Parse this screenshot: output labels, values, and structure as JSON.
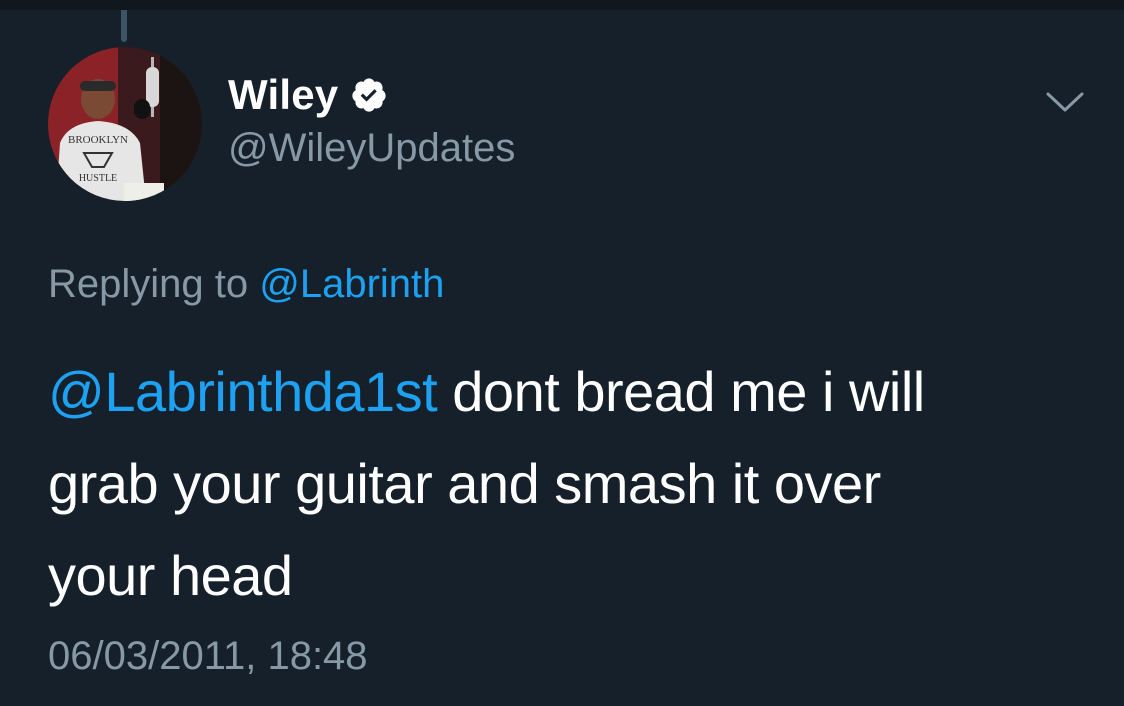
{
  "author": {
    "display_name": "Wiley",
    "handle": "@WileyUpdates",
    "verified": true,
    "avatar_shirt_text_top": "BROOKLYN",
    "avatar_shirt_text_bottom": "HUSTLE"
  },
  "reply": {
    "prefix": "Replying to",
    "target": "@Labrinth"
  },
  "tweet": {
    "mention": "@Labrinthda1st",
    "line1_rest": " dont bread me i will",
    "line2": "grab your guitar and smash it over",
    "line3": "your head"
  },
  "timestamp": "06/03/2011, 18:48",
  "icons": {
    "verified": "verified-badge-icon",
    "menu": "chevron-down-icon"
  },
  "colors": {
    "background": "#15202b",
    "text": "#ffffff",
    "secondary": "#8899a6",
    "link": "#1da1f2"
  }
}
